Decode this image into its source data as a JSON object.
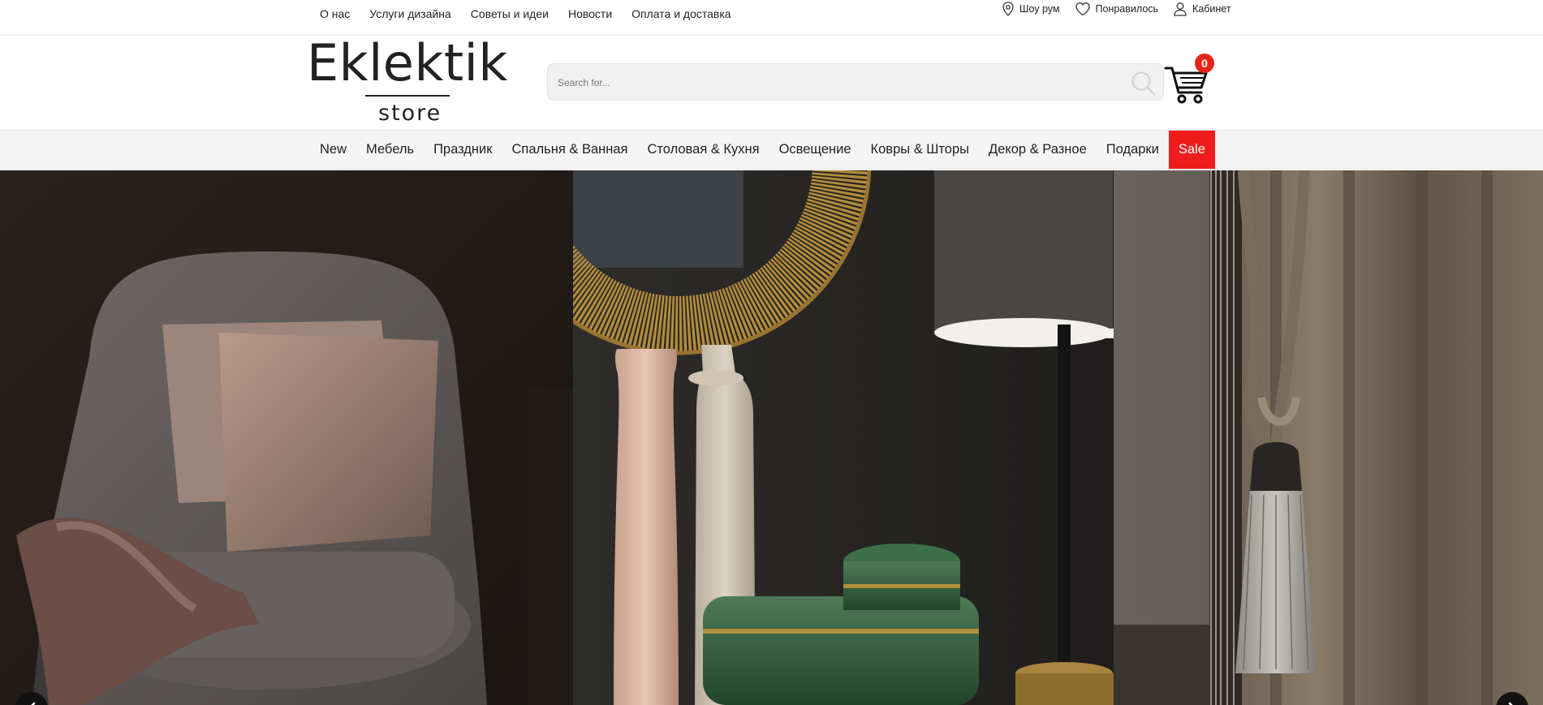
{
  "topnav": {
    "items": [
      {
        "label": "О нас"
      },
      {
        "label": "Услуги дизайна"
      },
      {
        "label": "Советы и идеи"
      },
      {
        "label": "Новости"
      },
      {
        "label": "Оплата и доставка"
      }
    ]
  },
  "utility": {
    "showroom": "Шоу рум",
    "wishlist": "Понравилось",
    "account": "Кабинет"
  },
  "logo": {
    "word": "Eklektik",
    "sub": "store"
  },
  "search": {
    "placeholder": "Search for..."
  },
  "cart": {
    "count": "0"
  },
  "categories": [
    {
      "label": "New"
    },
    {
      "label": "Мебель"
    },
    {
      "label": "Праздник"
    },
    {
      "label": "Спальня & Ванная"
    },
    {
      "label": "Столовая & Кухня"
    },
    {
      "label": "Освещение"
    },
    {
      "label": "Ковры & Шторы"
    },
    {
      "label": "Декор & Разное"
    },
    {
      "label": "Подарки"
    },
    {
      "label": "Sale"
    }
  ],
  "hero": {
    "slides": [
      {
        "icon": "armchair-photo"
      },
      {
        "icon": "vases-lamp-photo"
      },
      {
        "icon": "curtain-tassel-photo"
      }
    ]
  },
  "colors": {
    "accent": "#ee1c1c",
    "badge": "#e8241a",
    "text": "#222222"
  }
}
